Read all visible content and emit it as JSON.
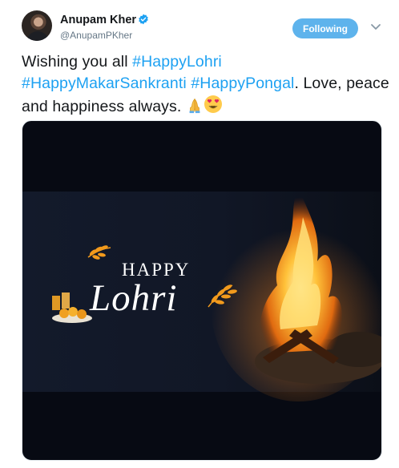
{
  "tweet": {
    "author_name": "Anupam Kher",
    "handle": "@AnupamPKher",
    "follow_label": "Following",
    "text_segments": [
      {
        "text": "Wishing you all ",
        "type": "text"
      },
      {
        "text": "#HappyLohri",
        "type": "hashtag"
      },
      {
        "text": "#HappyMakarSankranti",
        "type": "hashtag"
      },
      {
        "text": " ",
        "type": "text"
      },
      {
        "text": "#HappyPongal",
        "type": "hashtag"
      },
      {
        "text": ". Love, peace and happiness always.",
        "type": "text"
      }
    ],
    "emojis": [
      "folded-hands-icon",
      "heart-eyes-icon"
    ]
  },
  "media": {
    "line1": "HAPPY",
    "line2": "Lohri"
  },
  "colors": {
    "accent": "#1da1f2",
    "follow_button": "#5eb3ec",
    "handle_gray": "#657786",
    "media_bg": "#070a13"
  }
}
